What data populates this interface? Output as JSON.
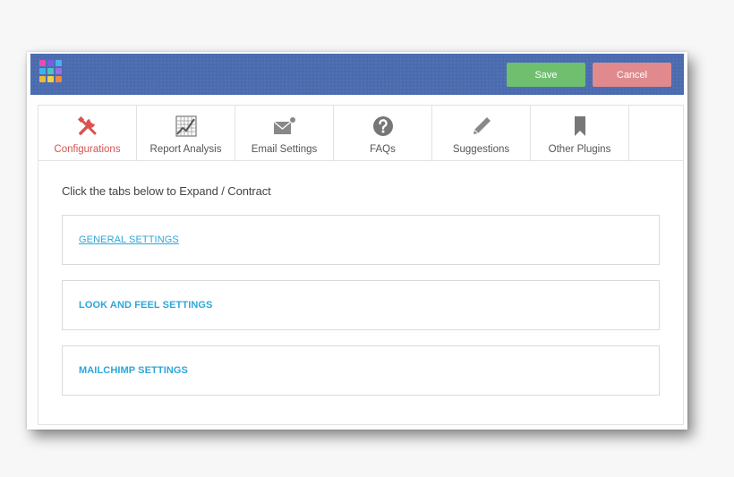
{
  "toolbar": {
    "save_label": "Save",
    "cancel_label": "Cancel",
    "logo_colors": [
      "#e84cb4",
      "#7c5ce8",
      "#4ab2f0",
      "#3fb2e8",
      "#4ac4c4",
      "#9a6ee8",
      "#f0b838",
      "#f0d048",
      "#f08a3a"
    ],
    "bar_color": "#4b6baf",
    "save_color": "#6fbf6f",
    "cancel_color": "#e08a8e"
  },
  "tabs": [
    {
      "label": "Configurations",
      "icon": "tools-icon",
      "active": true
    },
    {
      "label": "Report Analysis",
      "icon": "grid-chart-icon",
      "active": false
    },
    {
      "label": "Email Settings",
      "icon": "email-icon",
      "active": false
    },
    {
      "label": "FAQs",
      "icon": "question-circle-icon",
      "active": false
    },
    {
      "label": "Suggestions",
      "icon": "pencil-icon",
      "active": false
    },
    {
      "label": "Other Plugins",
      "icon": "bookmark-icon",
      "active": false
    }
  ],
  "main": {
    "hint": "Click the tabs below to Expand / Contract",
    "sections": [
      {
        "title": "GENERAL SETTINGS",
        "linked": true
      },
      {
        "title": "LOOK AND FEEL SETTINGS",
        "linked": false
      },
      {
        "title": "MAILCHIMP SETTINGS",
        "linked": false
      }
    ]
  },
  "colors": {
    "accent_active": "#d9534f",
    "section_title": "#2ea6d9"
  }
}
